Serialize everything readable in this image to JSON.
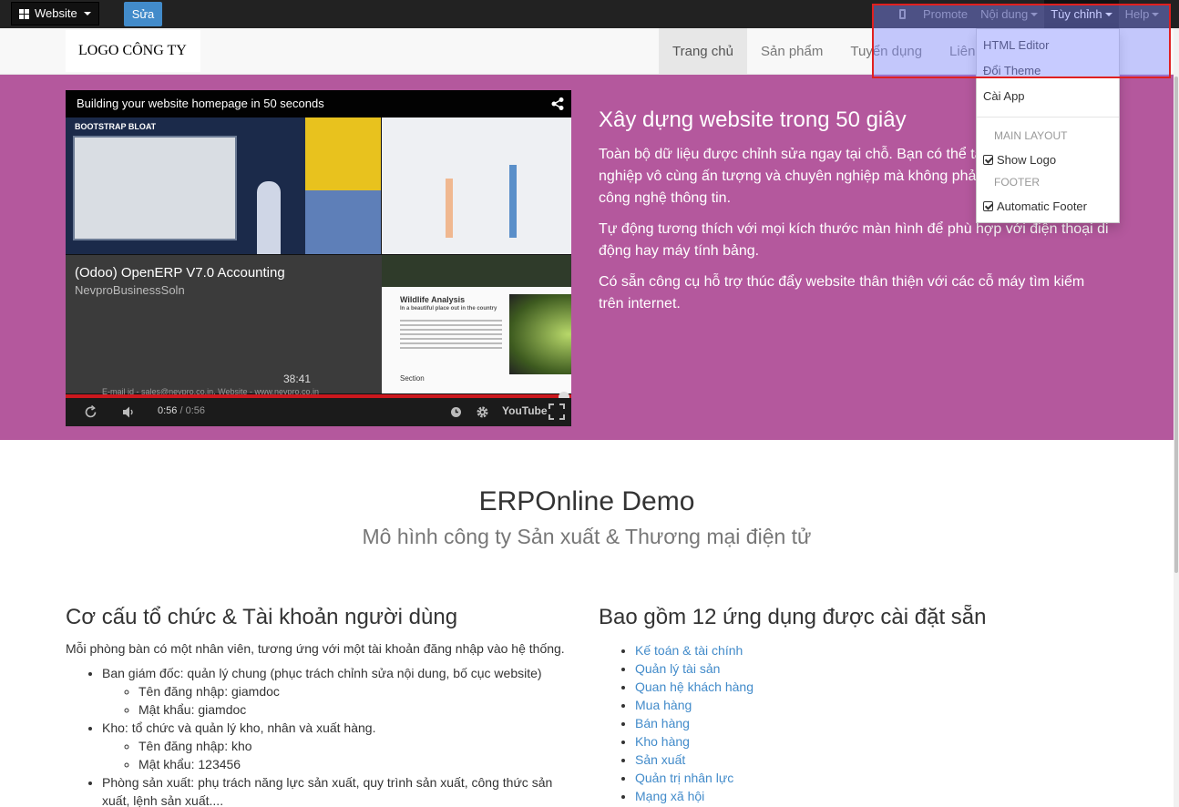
{
  "adminbar": {
    "website_label": "Website",
    "edit_label": "Sửa",
    "promote_label": "Promote",
    "content_label": "Nội dung",
    "customize_label": "Tùy chỉnh",
    "help_label": "Help"
  },
  "navbar": {
    "logo_text": "LOGO CÔNG TY",
    "menu": [
      "Trang chủ",
      "Sản phẩm",
      "Tuyển dụng",
      "Liên hệ"
    ]
  },
  "video": {
    "title": "Building your website homepage in 50 seconds",
    "overlay_title": "(Odoo) OpenERP V7.0 Accounting",
    "overlay_channel": "NevproBusinessSoln",
    "duration_badge": "38:41",
    "caption": "E-mail id - sales@nevpro.co.in, Website - www.nevpro.co.in",
    "current_time": "0:56",
    "total_time": "/ 0:56",
    "youtube_label": "YouTube",
    "thumb_text_1": "BOOTSTRAP BLOAT",
    "thumb_text_2": "Wildlife Analysis",
    "thumb_text_3": "In a beautiful place out in the country",
    "thumb_text_4": "Section"
  },
  "hero": {
    "heading": "Xây dựng website trong 50 giây",
    "p1": "Toàn bộ dữ liệu được chỉnh sửa ngay tại chỗ. Bạn có thể tạo website doanh nghiệp vô cùng ấn tượng và chuyên nghiệp mà không phải là một chuyên gia công nghệ thông tin.",
    "p2": "Tự động tương thích với mọi kích thước màn hình để phù hợp với điện thoại di động hay máy tính bảng.",
    "p3": "Có sẵn công cụ hỗ trợ thúc đẩy website thân thiện với các cỗ máy tìm kiếm trên internet."
  },
  "demo": {
    "title": "ERPOnline Demo",
    "subtitle": "Mô hình công ty Sản xuất & Thương mại điện tử"
  },
  "left": {
    "heading": "Cơ cấu tổ chức & Tài khoản người dùng",
    "intro": "Mỗi phòng bàn có một nhân viên, tương ứng với một tài khoản đăng nhập vào hệ thống.",
    "item1": "Ban giám đốc: quản lý chung (phục trách chỉnh sửa nội dung, bố cục website)",
    "item1_user": "Tên đăng nhập: giamdoc",
    "item1_pass": "Mật khẩu: giamdoc",
    "item2": "Kho: tổ chức và quản lý kho, nhân và xuất hàng.",
    "item2_user": "Tên đăng nhập: kho",
    "item2_pass": "Mật khẩu: 123456",
    "item3": "Phòng sản xuất: phụ trách năng lực sản xuất, quy trình sản xuất, công thức sản xuất, lệnh sản xuất...."
  },
  "right": {
    "heading": "Bao gồm 12 ứng dụng được cài đặt sẵn",
    "apps": [
      "Kế toán & tài chính",
      "Quản lý tài sản",
      "Quan hệ khách hàng",
      "Mua hàng",
      "Bán hàng",
      "Kho hàng",
      "Sản xuất",
      "Quản trị nhân lực",
      "Mạng xã hội"
    ]
  },
  "dropdown": {
    "html_editor": "HTML Editor",
    "change_theme": "Đổi Theme",
    "install_app": "Cài App",
    "main_layout": "MAIN LAYOUT",
    "show_logo": "Show Logo",
    "footer": "FOOTER",
    "auto_footer": "Automatic Footer"
  },
  "colors": {
    "hero_bg": "#b4589d",
    "primary": "#428bca",
    "highlight_border": "#e02020"
  }
}
